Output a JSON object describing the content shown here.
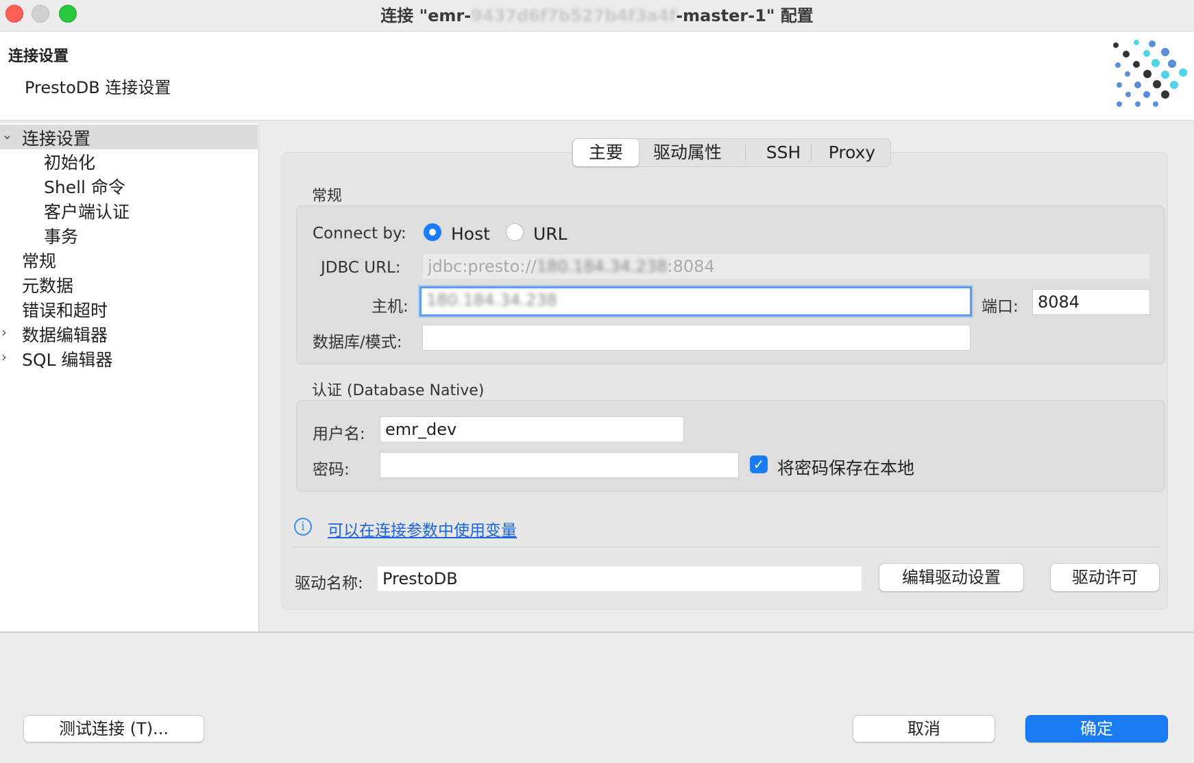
{
  "window": {
    "title_prefix": "连接 \"emr-",
    "title_hidden": "9437d6f7b527b4f3a4f",
    "title_suffix": "-master-1\" 配置"
  },
  "header": {
    "title": "连接设置",
    "subtitle": "PrestoDB 连接设置"
  },
  "sidebar": {
    "items": [
      {
        "label": "连接设置"
      },
      {
        "label": "初始化"
      },
      {
        "label": "Shell 命令"
      },
      {
        "label": "客户端认证"
      },
      {
        "label": "事务"
      },
      {
        "label": "常规"
      },
      {
        "label": "元数据"
      },
      {
        "label": "错误和超时"
      },
      {
        "label": "数据编辑器"
      },
      {
        "label": "SQL 编辑器"
      }
    ]
  },
  "tabs": [
    {
      "label": "主要"
    },
    {
      "label": "驱动属性"
    },
    {
      "label": "SSH"
    },
    {
      "label": "Proxy"
    }
  ],
  "general": {
    "section_label": "常规",
    "connect_by_label": "Connect by:",
    "host_option": "Host",
    "url_option": "URL",
    "jdbc_label": "JDBC URL:",
    "jdbc_prefix": "jdbc:presto://",
    "jdbc_host_hidden": "180.184.34.238",
    "jdbc_suffix": ":8084",
    "host_label": "主机:",
    "host_value": "180.184.34.238",
    "port_label": "端口:",
    "port_value": "8084",
    "db_label": "数据库/模式:",
    "db_value": ""
  },
  "auth": {
    "section_label": "认证 (Database Native)",
    "username_label": "用户名:",
    "username_value": "emr_dev",
    "password_label": "密码:",
    "password_value": "",
    "save_password_label": "将密码保存在本地"
  },
  "variables_link": "可以在连接参数中使用变量",
  "driver": {
    "name_label": "驱动名称:",
    "name_value": "PrestoDB",
    "edit_button": "编辑驱动设置",
    "license_button": "驱动许可"
  },
  "footer": {
    "test_button": "测试连接 (T)...",
    "cancel_button": "取消",
    "ok_button": "确定"
  },
  "colors": {
    "accent": "#1a7cf5",
    "link": "#1a64d6"
  }
}
